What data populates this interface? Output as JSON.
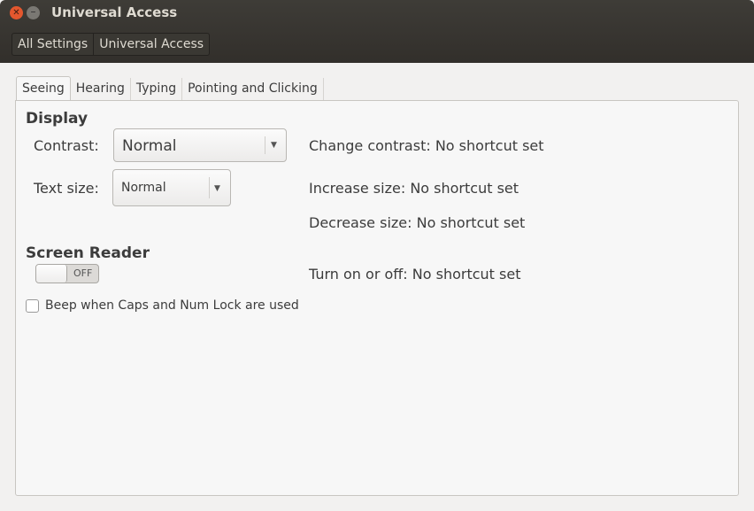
{
  "window": {
    "title": "Universal Access"
  },
  "breadcrumb": [
    "All Settings",
    "Universal Access"
  ],
  "tabs": [
    "Seeing",
    "Hearing",
    "Typing",
    "Pointing and Clicking"
  ],
  "display": {
    "heading": "Display",
    "contrast_label": "Contrast:",
    "contrast_value": "Normal",
    "text_size_label": "Text size:",
    "text_size_value": "Normal"
  },
  "shortcuts": {
    "change_contrast_label": "Change contrast:",
    "change_contrast_value": "No shortcut set",
    "increase_label": "Increase size:",
    "increase_value": "No shortcut set",
    "decrease_label": "Decrease size:",
    "decrease_value": "No shortcut set",
    "toggle_label": "Turn on or off:",
    "toggle_value": "No shortcut set"
  },
  "screen_reader": {
    "heading": "Screen Reader",
    "switch_state": "OFF"
  },
  "beep": {
    "label": "Beep when Caps and Num Lock are used",
    "checked": false
  }
}
